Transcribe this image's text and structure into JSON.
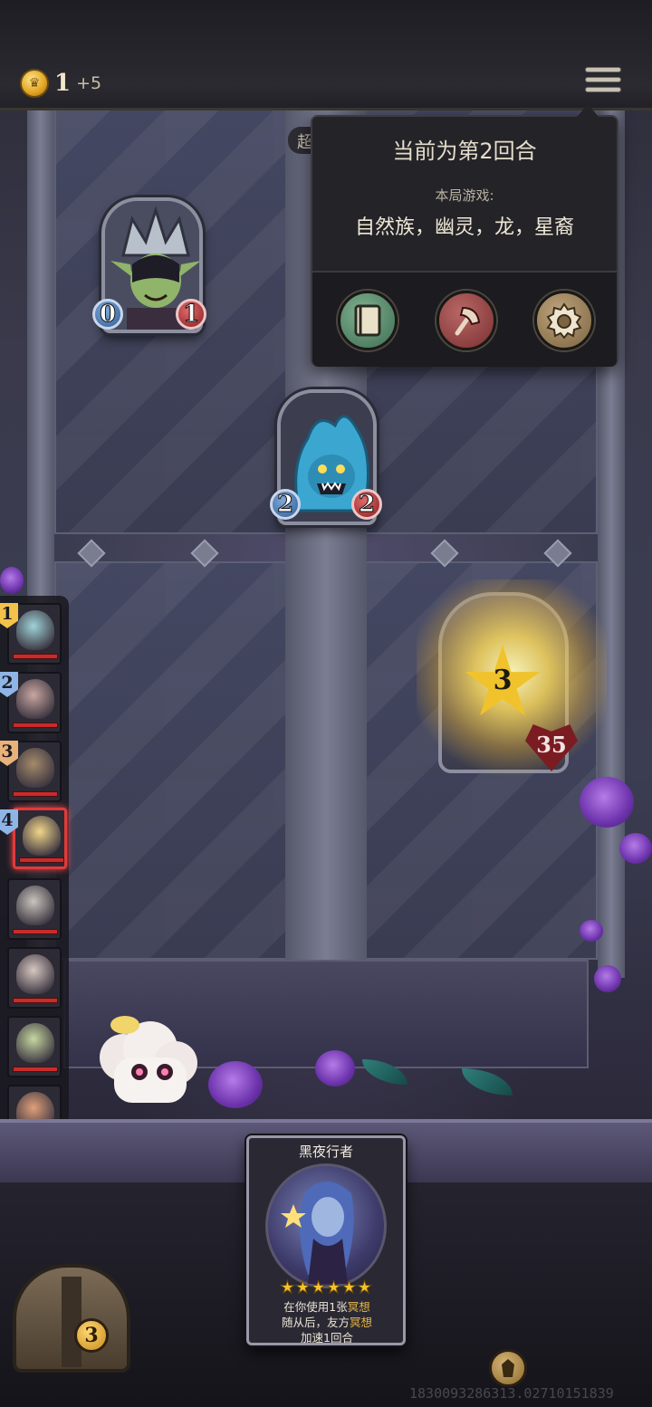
{
  "topbar": {
    "gold_value": "1",
    "gold_increment": "+5",
    "menu_icon": "hamburger-menu-icon"
  },
  "menu_popup": {
    "round_text": "当前为第2回合",
    "game_label": "本局游戏:",
    "tribes": "自然族，幽灵，龙，星裔",
    "buttons": [
      {
        "icon": "book-icon"
      },
      {
        "icon": "axe-icon"
      },
      {
        "icon": "gear-icon"
      }
    ]
  },
  "board": {
    "enemy_minion": {
      "attack": "0",
      "health": "1"
    },
    "player_minion": {
      "attack": "2",
      "health": "2"
    },
    "opponent_hero": {
      "level": "3",
      "health": "35"
    }
  },
  "sidebar": {
    "heroes": [
      {
        "rank": "1",
        "face_color": "#9fd3d8"
      },
      {
        "rank": "2",
        "face_color": "#c9a6a0"
      },
      {
        "rank": "3",
        "face_color": "#a48a6a"
      },
      {
        "rank": "4",
        "face_color": "#f2d68a",
        "active": true
      },
      {
        "face_color": "#c9c4bc"
      },
      {
        "face_color": "#d7c7c0"
      },
      {
        "face_color": "#c7d7a0"
      },
      {
        "face_color": "#e0a07a"
      }
    ],
    "colors": {
      "gold_rank": "#f2c24a",
      "blue_rank": "#8fb5e6",
      "orange_rank": "#e8b27a",
      "hp_bar": "#c92b2b"
    }
  },
  "hand_card": {
    "name": "黑夜行者",
    "stars": "★★★★★★",
    "text_line1_prefix": "在你使用1张",
    "text_line1_keyword": "冥想",
    "text_line2_prefix": "随从后，友方",
    "text_line2_keyword": "冥想",
    "text_line3": "加速1回合"
  },
  "bottom": {
    "chest_count": "3",
    "watermark": "1830093286313.02710151839"
  },
  "hidden_banner_char": "超"
}
